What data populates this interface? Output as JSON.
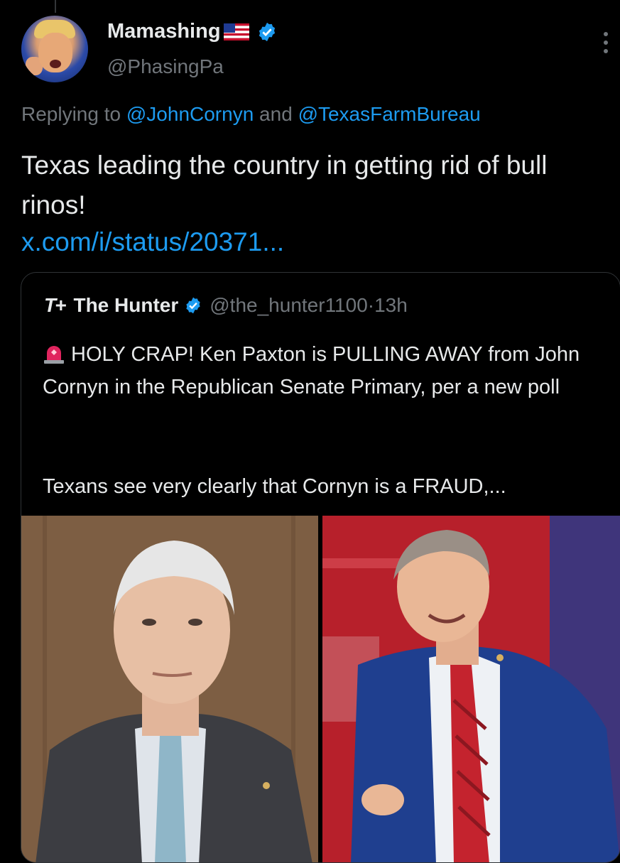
{
  "author": {
    "display_name": "Mamashing",
    "flag_icon": "us-flag-icon",
    "handle": "@PhasingPa",
    "verified": true
  },
  "reply": {
    "prefix": "Replying to ",
    "mention1": "@JohnCornyn",
    "joiner": " and ",
    "mention2": "@TexasFarmBureau"
  },
  "tweet": {
    "text": "Texas leading the country in getting rid of bull rinos!",
    "link": "x.com/i/status/20371..."
  },
  "quote": {
    "logo": "T+",
    "name": "The Hunter",
    "handle": "@the_hunter1100",
    "separator": " · ",
    "time": "13h",
    "text": "HOLY CRAP! Ken Paxton is PULLING AWAY from John Cornyn in the Republican Senate Primary, per a new poll",
    "text2": "Texans see very clearly that Cornyn is a FRAUD,..."
  },
  "colors": {
    "background": "#000000",
    "text": "#e7e9ea",
    "muted": "#71767b",
    "link": "#1d9bf0",
    "border": "#2f3336"
  }
}
